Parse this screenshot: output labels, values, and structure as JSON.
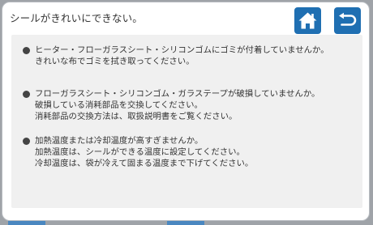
{
  "dialog": {
    "title": "シールがきれいにできない。",
    "home_icon": "home-icon",
    "back_icon": "return-arrow-icon",
    "accent_color": "#1f6fb2"
  },
  "items": [
    {
      "lines": [
        "ヒーター・フローガラスシート・シリコンゴムにゴミが付着していませんか。",
        "きれいな布でゴミを拭き取ってください。"
      ]
    },
    {
      "lines": [
        "フローガラスシート・シリコンゴム・ガラステープが破損していませんか。",
        "破損している消耗部品を交換してください。",
        "消耗部品の交換方法は、取扱説明書をご覧ください。"
      ]
    },
    {
      "lines": [
        "加熱温度または冷却温度が高すぎませんか。",
        "加熱温度は、シールができる温度に設定してください。",
        "冷却温度は、袋が冷えて固まる温度まで下げてください。"
      ]
    }
  ]
}
